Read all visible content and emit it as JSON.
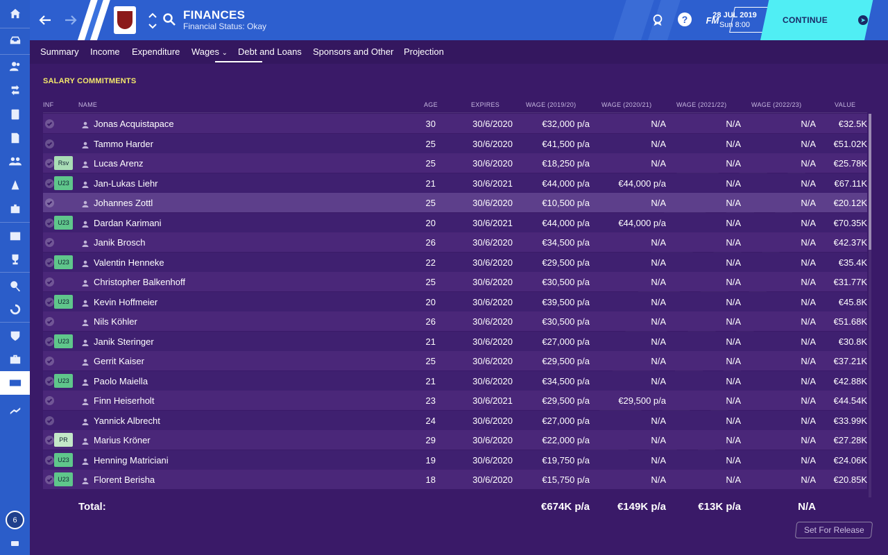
{
  "header": {
    "title": "FINANCES",
    "subtitle": "Financial Status: Okay",
    "date": "28 JUL 2019",
    "time": "Sun 8:00",
    "continue_label": "CONTINUE",
    "fm_logo": "FM",
    "help_label": "?"
  },
  "tabs": [
    "Summary",
    "Income",
    "Expenditure",
    "Wages",
    "Debt and Loans",
    "Sponsors and Other",
    "Projection"
  ],
  "active_tab": "Wages",
  "sidebar": {
    "items": [
      "home",
      "inbox",
      "squad",
      "dynamics",
      "training",
      "reports",
      "staff",
      "tactics",
      "medical",
      "schedule",
      "competitions",
      "scouting",
      "transfers",
      "club-info",
      "development",
      "finances",
      "career"
    ],
    "active": "finances",
    "badge": "6"
  },
  "section_title": "SALARY COMMITMENTS",
  "columns": {
    "inf": "INF",
    "name": "NAME",
    "age": "AGE",
    "expires": "EXPIRES",
    "w1": "WAGE (2019/20)",
    "w2": "WAGE (2020/21)",
    "w3": "WAGE (2021/22)",
    "w4": "WAGE (2022/23)",
    "value": "VALUE"
  },
  "rows": [
    {
      "tag": "",
      "name": "Jonas Acquistapace",
      "age": "30",
      "expires": "30/6/2020",
      "w1": "€32,000 p/a",
      "w2": "N/A",
      "w3": "N/A",
      "w4": "N/A",
      "value": "€32.5K"
    },
    {
      "tag": "",
      "name": "Tammo Harder",
      "age": "25",
      "expires": "30/6/2020",
      "w1": "€41,500 p/a",
      "w2": "N/A",
      "w3": "N/A",
      "w4": "N/A",
      "value": "€51.02K"
    },
    {
      "tag": "Rsv",
      "name": "Lucas Arenz",
      "age": "25",
      "expires": "30/6/2020",
      "w1": "€18,250 p/a",
      "w2": "N/A",
      "w3": "N/A",
      "w4": "N/A",
      "value": "€25.78K"
    },
    {
      "tag": "U23",
      "name": "Jan-Lukas Liehr",
      "age": "21",
      "expires": "30/6/2021",
      "w1": "€44,000 p/a",
      "w2": "€44,000 p/a",
      "w3": "N/A",
      "w4": "N/A",
      "value": "€67.11K"
    },
    {
      "tag": "",
      "name": "Johannes Zottl",
      "age": "25",
      "expires": "30/6/2020",
      "w1": "€10,500 p/a",
      "w2": "N/A",
      "w3": "N/A",
      "w4": "N/A",
      "value": "€20.12K",
      "highlight": true
    },
    {
      "tag": "U23",
      "name": "Dardan Karimani",
      "age": "20",
      "expires": "30/6/2021",
      "w1": "€44,000 p/a",
      "w2": "€44,000 p/a",
      "w3": "N/A",
      "w4": "N/A",
      "value": "€70.35K"
    },
    {
      "tag": "",
      "name": "Janik Brosch",
      "age": "26",
      "expires": "30/6/2020",
      "w1": "€34,500 p/a",
      "w2": "N/A",
      "w3": "N/A",
      "w4": "N/A",
      "value": "€42.37K"
    },
    {
      "tag": "U23",
      "name": "Valentin Henneke",
      "age": "22",
      "expires": "30/6/2020",
      "w1": "€29,500 p/a",
      "w2": "N/A",
      "w3": "N/A",
      "w4": "N/A",
      "value": "€35.4K"
    },
    {
      "tag": "",
      "name": "Christopher Balkenhoff",
      "age": "25",
      "expires": "30/6/2020",
      "w1": "€30,500 p/a",
      "w2": "N/A",
      "w3": "N/A",
      "w4": "N/A",
      "value": "€31.77K"
    },
    {
      "tag": "U23",
      "name": "Kevin Hoffmeier",
      "age": "20",
      "expires": "30/6/2020",
      "w1": "€39,500 p/a",
      "w2": "N/A",
      "w3": "N/A",
      "w4": "N/A",
      "value": "€45.8K"
    },
    {
      "tag": "",
      "name": "Nils Köhler",
      "age": "26",
      "expires": "30/6/2020",
      "w1": "€30,500 p/a",
      "w2": "N/A",
      "w3": "N/A",
      "w4": "N/A",
      "value": "€51.68K"
    },
    {
      "tag": "U23",
      "name": "Janik Steringer",
      "age": "21",
      "expires": "30/6/2020",
      "w1": "€27,000 p/a",
      "w2": "N/A",
      "w3": "N/A",
      "w4": "N/A",
      "value": "€30.8K"
    },
    {
      "tag": "",
      "name": "Gerrit Kaiser",
      "age": "25",
      "expires": "30/6/2020",
      "w1": "€29,500 p/a",
      "w2": "N/A",
      "w3": "N/A",
      "w4": "N/A",
      "value": "€37.21K"
    },
    {
      "tag": "U23",
      "name": "Paolo Maiella",
      "age": "21",
      "expires": "30/6/2020",
      "w1": "€34,500 p/a",
      "w2": "N/A",
      "w3": "N/A",
      "w4": "N/A",
      "value": "€42.88K"
    },
    {
      "tag": "",
      "name": "Finn Heiserholt",
      "age": "23",
      "expires": "30/6/2021",
      "w1": "€29,500 p/a",
      "w2": "€29,500 p/a",
      "w3": "N/A",
      "w4": "N/A",
      "value": "€44.54K"
    },
    {
      "tag": "",
      "name": "Yannick Albrecht",
      "age": "24",
      "expires": "30/6/2020",
      "w1": "€27,000 p/a",
      "w2": "N/A",
      "w3": "N/A",
      "w4": "N/A",
      "value": "€33.99K"
    },
    {
      "tag": "PR",
      "name": "Marius Kröner",
      "age": "29",
      "expires": "30/6/2020",
      "w1": "€22,000 p/a",
      "w2": "N/A",
      "w3": "N/A",
      "w4": "N/A",
      "value": "€27.28K"
    },
    {
      "tag": "U23",
      "name": "Henning Matriciani",
      "age": "19",
      "expires": "30/6/2020",
      "w1": "€19,750 p/a",
      "w2": "N/A",
      "w3": "N/A",
      "w4": "N/A",
      "value": "€24.06K"
    },
    {
      "tag": "U23",
      "name": "Florent Berisha",
      "age": "18",
      "expires": "30/6/2020",
      "w1": "€15,750 p/a",
      "w2": "N/A",
      "w3": "N/A",
      "w4": "N/A",
      "value": "€20.85K"
    }
  ],
  "totals": {
    "label": "Total:",
    "w1": "€674K p/a",
    "w2": "€149K p/a",
    "w3": "€13K p/a",
    "w4": "N/A"
  },
  "release_button": "Set For Release"
}
